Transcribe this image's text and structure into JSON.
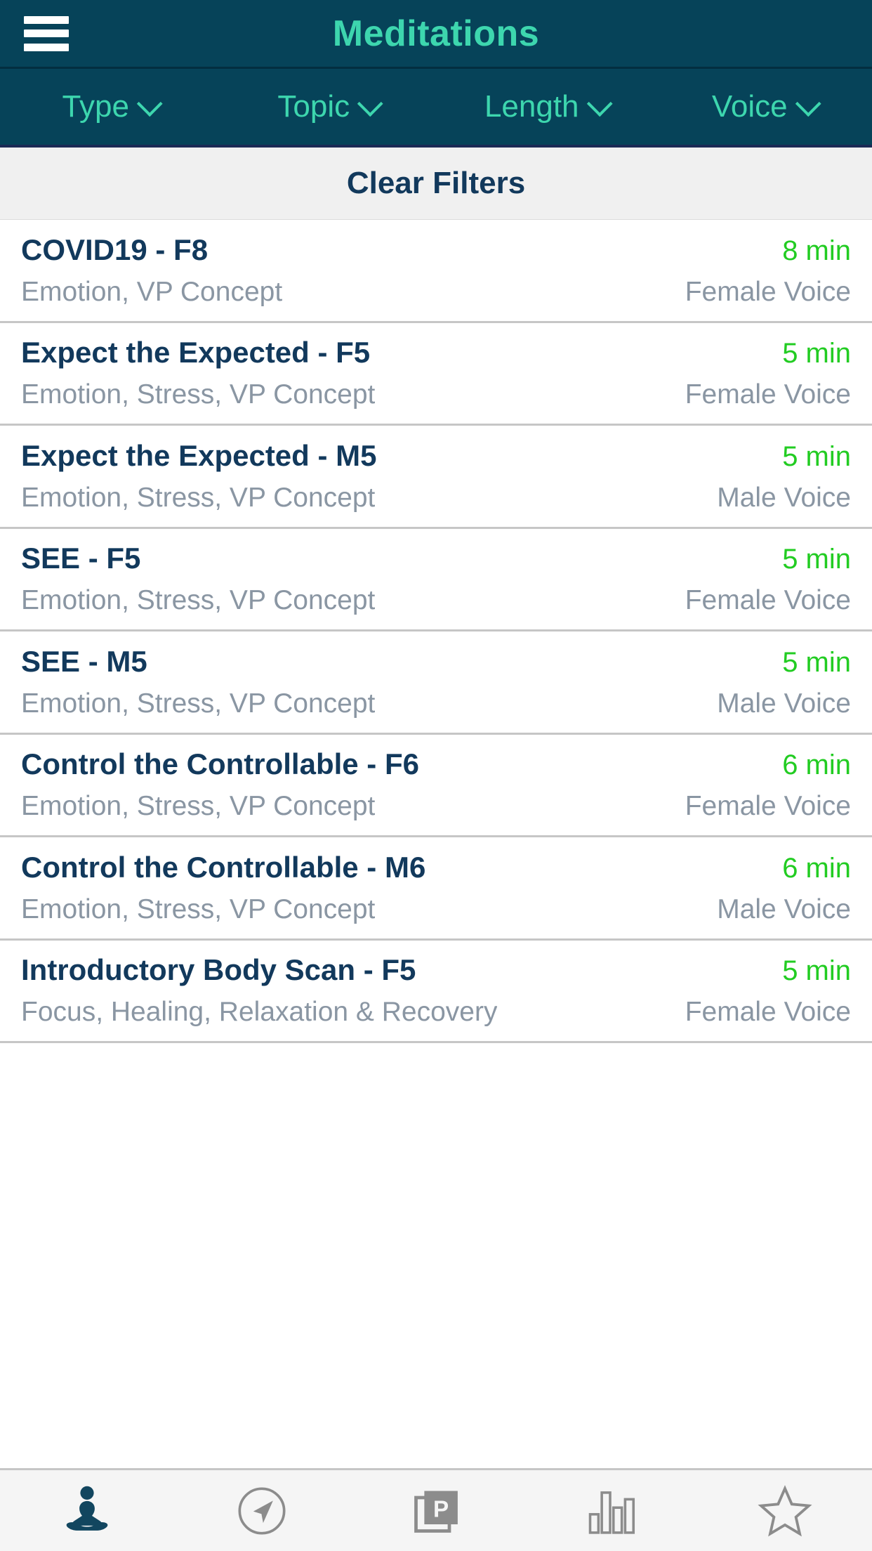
{
  "header": {
    "menu_icon": "hamburger-menu-icon",
    "title": "Meditations"
  },
  "filters": [
    {
      "label": "Type",
      "icon": "chevron-down-icon"
    },
    {
      "label": "Topic",
      "icon": "chevron-down-icon"
    },
    {
      "label": "Length",
      "icon": "chevron-down-icon"
    },
    {
      "label": "Voice",
      "icon": "chevron-down-icon"
    }
  ],
  "clear_filters": {
    "label": "Clear Filters"
  },
  "list": {
    "items": [
      {
        "title": "COVID19 - F8",
        "duration": "8 min",
        "tags": "Emotion, VP Concept",
        "voice": "Female Voice"
      },
      {
        "title": "Expect the Expected - F5",
        "duration": "5 min",
        "tags": "Emotion, Stress, VP Concept",
        "voice": "Female Voice"
      },
      {
        "title": "Expect the Expected - M5",
        "duration": "5 min",
        "tags": "Emotion, Stress, VP Concept",
        "voice": "Male Voice"
      },
      {
        "title": "SEE - F5",
        "duration": "5 min",
        "tags": "Emotion, Stress, VP Concept",
        "voice": "Female Voice"
      },
      {
        "title": "SEE - M5",
        "duration": "5 min",
        "tags": "Emotion, Stress, VP Concept",
        "voice": "Male Voice"
      },
      {
        "title": "Control the Controllable - F6",
        "duration": "6 min",
        "tags": "Emotion, Stress, VP Concept",
        "voice": "Female Voice"
      },
      {
        "title": "Control the Controllable - M6",
        "duration": "6 min",
        "tags": "Emotion, Stress, VP Concept",
        "voice": "Male Voice"
      },
      {
        "title": "Introductory Body Scan - F5",
        "duration": "5 min",
        "tags": "Focus, Healing, Relaxation & Recovery",
        "voice": "Female Voice"
      }
    ]
  },
  "tabbar": {
    "tabs": [
      {
        "icon": "meditation-lotus-icon",
        "active": true
      },
      {
        "icon": "compass-navigate-icon",
        "active": false
      },
      {
        "icon": "p-cards-icon",
        "active": false
      },
      {
        "icon": "bar-chart-icon",
        "active": false
      },
      {
        "icon": "star-icon",
        "active": false
      }
    ]
  },
  "colors": {
    "header_bg": "#064359",
    "accent_mint": "#3dd6ae",
    "title_navy": "#12395c",
    "duration_green": "#22cc22",
    "muted_gray": "#8a96a3",
    "clear_bar_bg": "#f0f0f0",
    "tabbar_bg": "#f5f5f5",
    "separator": "#c6c6c6",
    "tab_active": "#12465f",
    "tab_inactive": "#8c8c8c"
  }
}
